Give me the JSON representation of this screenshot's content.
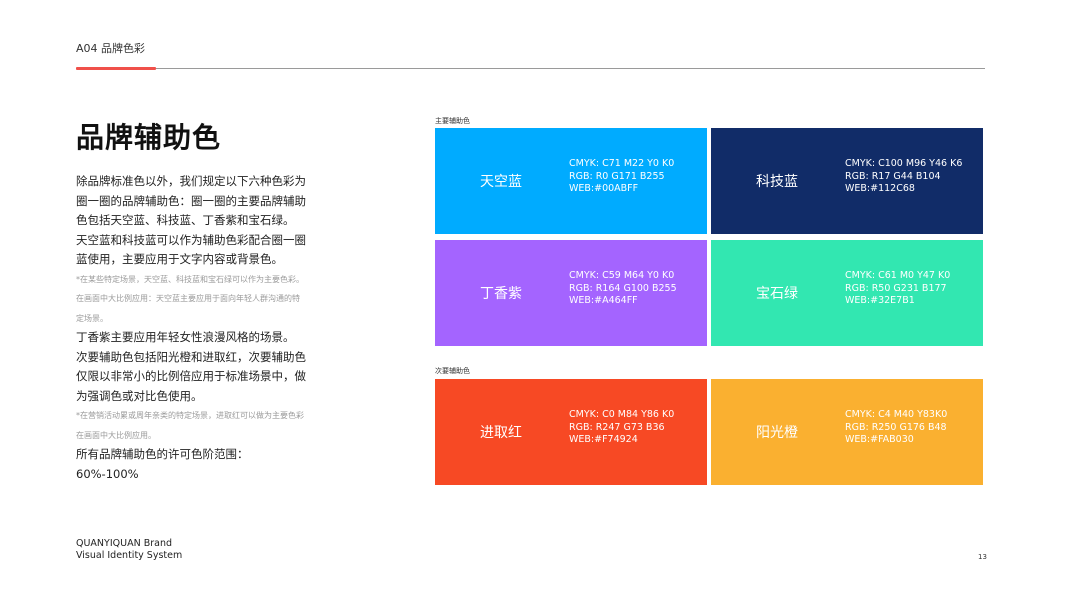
{
  "header": {
    "label": "A04 品牌色彩"
  },
  "page": {
    "title": "品牌辅助色",
    "page_number": "13"
  },
  "body": {
    "paragraphs": [
      {
        "kind": "main",
        "text": "除品牌标准色以外，我们规定以下六种色彩为圈一圈的品牌辅助色：圈一圈的主要品牌辅助色包括天空蓝、科技蓝、丁香紫和宝石绿。"
      },
      {
        "kind": "main",
        "text": "天空蓝和科技蓝可以作为辅助色彩配合圈一圈蓝使用，主要应用于文字内容或背景色。"
      },
      {
        "kind": "note",
        "text": "*在某些特定场景，天空蓝、科技蓝和宝石绿可以作为主要色彩。在画面中大比例应用：天空蓝主要应用于面向年轻人群沟通的特定场景。"
      },
      {
        "kind": "main",
        "text": "丁香紫主要应用年轻女性浪漫风格的场景。"
      },
      {
        "kind": "main",
        "text": "次要辅助色包括阳光橙和进取红，次要辅助色仅限以非常小的比例倍应用于标准场景中，做为强调色或对比色使用。"
      },
      {
        "kind": "note",
        "text": "*在营销活动累或周年亲类的特定场景，进取红可以做为主要色彩在画面中大比例应用。"
      },
      {
        "kind": "main",
        "text": "所有品牌辅助色的许可色阶范围：60%-100%"
      }
    ]
  },
  "primary": {
    "label": "主要辅助色",
    "swatches": [
      {
        "name": "天空蓝",
        "color": "#00ABFF",
        "cmyk": "CMYK: C71 M22 Y0 K0",
        "rgb": "RGB: R0 G171 B255",
        "web": "WEB:#00ABFF"
      },
      {
        "name": "科技蓝",
        "color": "#112C68",
        "cmyk": "CMYK: C100 M96 Y46 K6",
        "rgb": "RGB: R17 G44 B104",
        "web": "WEB:#112C68"
      },
      {
        "name": "丁香紫",
        "color": "#A464FF",
        "cmyk": "CMYK: C59 M64 Y0 K0",
        "rgb": "RGB: R164 G100 B255",
        "web": "WEB:#A464FF"
      },
      {
        "name": "宝石绿",
        "color": "#32E7B1",
        "cmyk": "CMYK: C61 M0 Y47 K0",
        "rgb": "RGB: R50 G231 B177",
        "web": "WEB:#32E7B1"
      }
    ]
  },
  "secondary": {
    "label": "次要辅助色",
    "swatches": [
      {
        "name": "进取红",
        "color": "#F74924",
        "cmyk": "CMYK: C0 M84 Y86 K0",
        "rgb": "RGB: R247 G73 B36",
        "web": "WEB:#F74924"
      },
      {
        "name": "阳光橙",
        "color": "#FAB030",
        "cmyk": "CMYK: C4 M40 Y83K0",
        "rgb": "RGB: R250 G176 B48",
        "web": "WEB:#FAB030"
      }
    ]
  },
  "footer": {
    "brand_line1": "QUANYIQUAN Brand",
    "brand_line2": "Visual Identity System"
  }
}
